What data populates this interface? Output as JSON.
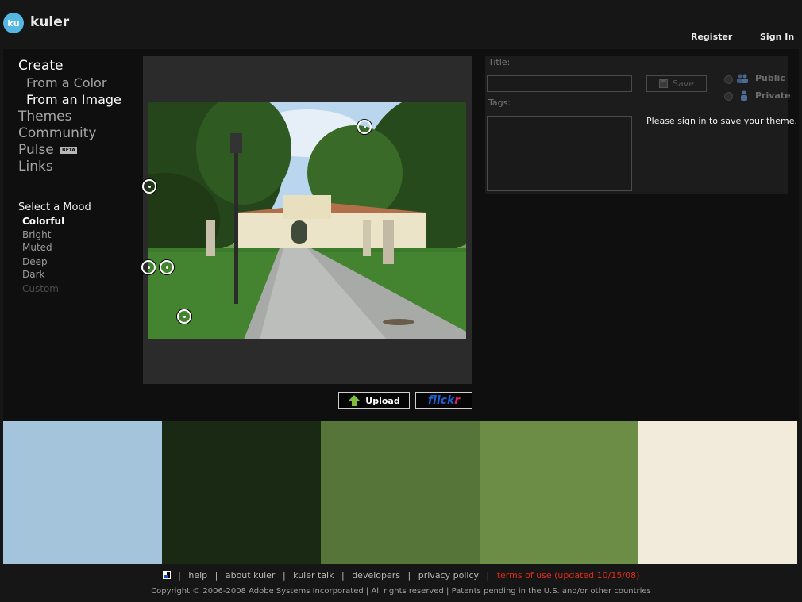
{
  "header": {
    "logo_badge": "ku",
    "logo_text": "kuler",
    "register": "Register",
    "sign_in": "Sign In"
  },
  "nav": {
    "create": "Create",
    "from_a_color": "From a Color",
    "from_an_image": "From an Image",
    "themes": "Themes",
    "community": "Community",
    "pulse": "Pulse",
    "pulse_badge": "BETA",
    "links": "Links"
  },
  "mood": {
    "title": "Select a Mood",
    "items": [
      "Colorful",
      "Bright",
      "Muted",
      "Deep",
      "Dark",
      "Custom"
    ],
    "selected": "Colorful"
  },
  "image_buttons": {
    "upload": "Upload",
    "flickr_a": "flick",
    "flickr_b": "r"
  },
  "form": {
    "title_label": "Title:",
    "title_value": "",
    "tags_label": "Tags:",
    "tags_value": "",
    "save": "Save",
    "public": "Public",
    "private": "Private",
    "signin_message": "Please sign in to save your theme."
  },
  "swatches": [
    "#a3c4db",
    "#1a2913",
    "#557539",
    "#6b8d46",
    "#f2eadb"
  ],
  "footer": {
    "help": "help",
    "about": "about kuler",
    "talk": "kuler talk",
    "developers": "developers",
    "privacy": "privacy policy",
    "terms": "terms of use (updated 10/15/08)",
    "separator": "|",
    "copyright": "Copyright © 2006-2008 Adobe Systems Incorporated | All rights reserved | Patents pending in the U.S. and/or other countries"
  }
}
